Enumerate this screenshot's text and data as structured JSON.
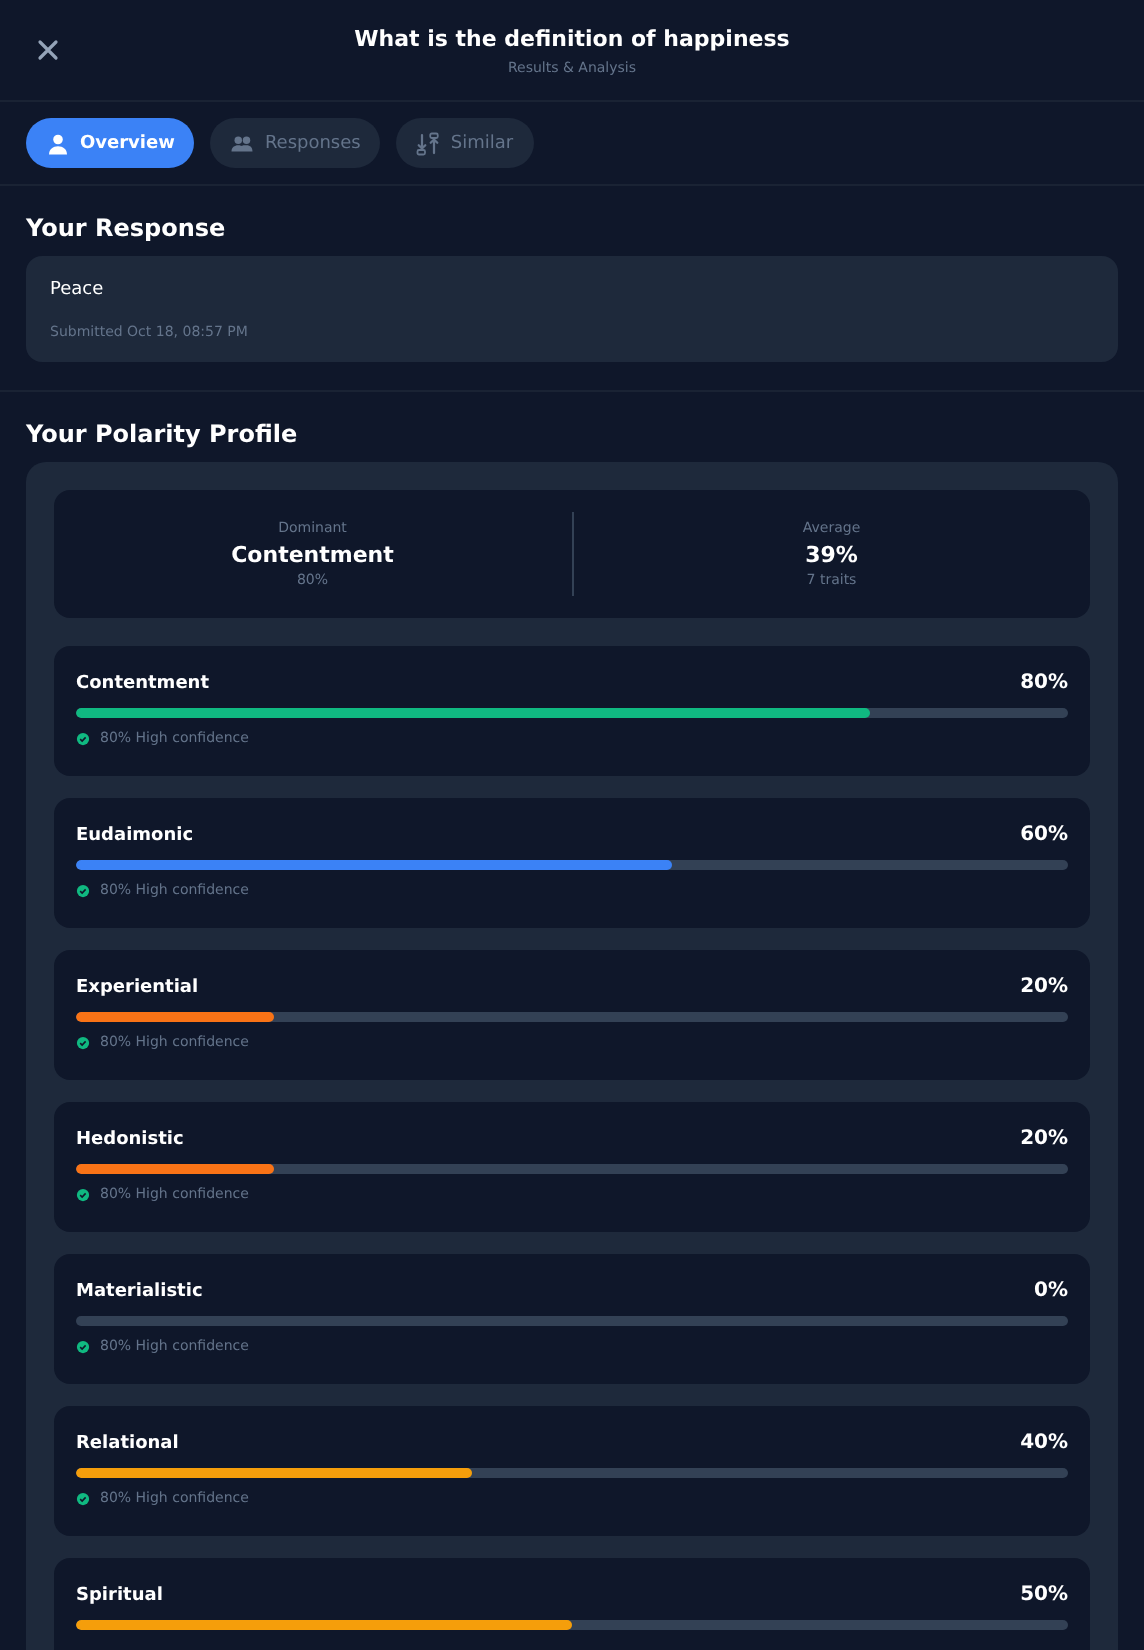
{
  "header": {
    "title": "What is the definition of happiness",
    "subtitle": "Results & Analysis"
  },
  "tabs": [
    {
      "label": "Overview",
      "selected": true
    },
    {
      "label": "Responses",
      "selected": false
    },
    {
      "label": "Similar",
      "selected": false
    }
  ],
  "response": {
    "heading": "Your Response",
    "text": "Peace",
    "submitted": "Submitted Oct 18, 08:57 PM"
  },
  "profile": {
    "heading": "Your Polarity Profile",
    "summary": [
      {
        "label": "Dominant",
        "value": "Contentment",
        "detail": "80%"
      },
      {
        "label": "Average",
        "value": "39%",
        "detail": "7 traits"
      }
    ],
    "traits": [
      {
        "name": "Contentment",
        "percent": "80%",
        "level": 0.8,
        "color": "#10b981",
        "confidence": "80% High confidence"
      },
      {
        "name": "Eudaimonic",
        "percent": "60%",
        "level": 0.6,
        "color": "#3b82f6",
        "confidence": "80% High confidence"
      },
      {
        "name": "Experiential",
        "percent": "20%",
        "level": 0.2,
        "color": "#f97316",
        "confidence": "80% High confidence"
      },
      {
        "name": "Hedonistic",
        "percent": "20%",
        "level": 0.2,
        "color": "#f97316",
        "confidence": "80% High confidence"
      },
      {
        "name": "Materialistic",
        "percent": "0%",
        "confidence": "80% High confidence"
      },
      {
        "name": "Relational",
        "percent": "40%",
        "level": 0.4,
        "color": "#f59e0b",
        "confidence": "80% High confidence"
      },
      {
        "name": "Spiritual",
        "percent": "50%",
        "level": 0.5,
        "color": "#f59e0b"
      }
    ]
  }
}
